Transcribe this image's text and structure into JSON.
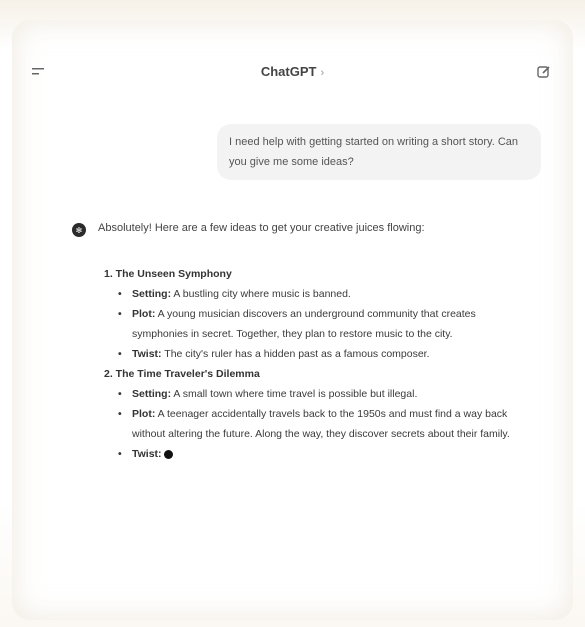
{
  "header": {
    "title": "ChatGPT",
    "chevron": "›",
    "menu_icon": "menu-icon",
    "new_chat_icon": "new-chat-icon"
  },
  "user_message": "I need help with getting started on writing a short story. Can you give me some ideas?",
  "assistant": {
    "avatar": "✻",
    "intro": "Absolutely! Here are a few ideas to get your creative juices flowing:",
    "ideas": [
      {
        "title": "1. The Unseen Symphony",
        "bullets": [
          {
            "label": "Setting:",
            "text": " A bustling city where music is banned."
          },
          {
            "label": "Plot:",
            "text": " A young musician discovers an underground community that creates symphonies in secret. Together, they plan to restore music to the city."
          },
          {
            "label": "Twist:",
            "text": " The city's ruler has a hidden past as a famous composer."
          }
        ]
      },
      {
        "title": "2. The Time Traveler's Dilemma",
        "bullets": [
          {
            "label": "Setting:",
            "text": " A small town where time travel is possible but illegal."
          },
          {
            "label": "Plot:",
            "text": " A teenager accidentally travels back to the 1950s and must find a way back without altering the future. Along the way, they discover secrets about their family."
          },
          {
            "label": "Twist:",
            "text": ""
          }
        ]
      }
    ]
  }
}
